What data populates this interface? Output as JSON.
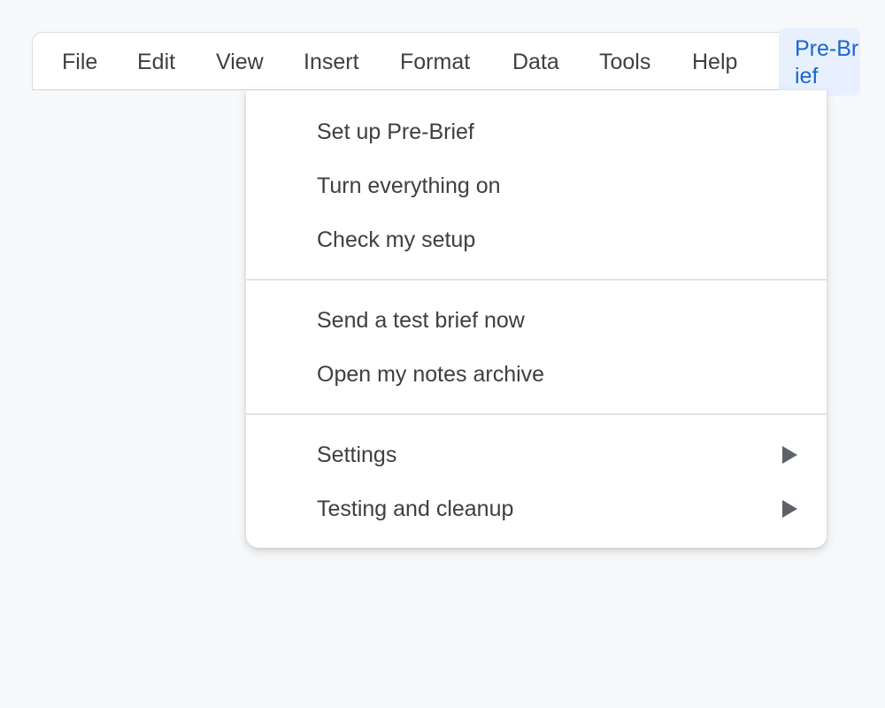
{
  "menubar": {
    "items": [
      {
        "label": "File"
      },
      {
        "label": "Edit"
      },
      {
        "label": "View"
      },
      {
        "label": "Insert"
      },
      {
        "label": "Format"
      },
      {
        "label": "Data"
      },
      {
        "label": "Tools"
      },
      {
        "label": "Help"
      },
      {
        "label": "Pre-Brief",
        "active": true
      }
    ]
  },
  "dropdown": {
    "groups": [
      {
        "items": [
          {
            "label": "Set up Pre-Brief"
          },
          {
            "label": "Turn everything on"
          },
          {
            "label": "Check my setup"
          }
        ]
      },
      {
        "items": [
          {
            "label": "Send a test brief now"
          },
          {
            "label": "Open my notes archive"
          }
        ]
      },
      {
        "items": [
          {
            "label": "Settings",
            "submenu": true,
            "icon": "submenu-arrow-icon"
          },
          {
            "label": "Testing and cleanup",
            "submenu": true,
            "icon": "submenu-arrow-icon"
          }
        ]
      }
    ]
  },
  "colors": {
    "background": "#f7f8fa",
    "active_tab_bg": "#e8f0fe",
    "active_tab_text": "#1a66d2",
    "menu_text": "#3c4043",
    "arrow": "#5f6368"
  }
}
